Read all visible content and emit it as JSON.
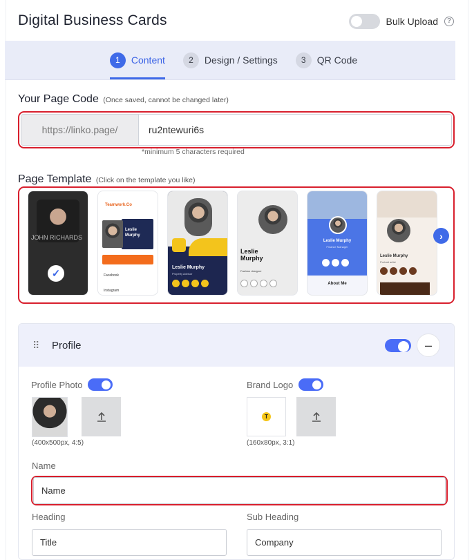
{
  "header": {
    "title": "Digital Business Cards",
    "bulk_label": "Bulk Upload",
    "help_symbol": "?"
  },
  "steps": [
    {
      "num": "1",
      "label": "Content",
      "active": true
    },
    {
      "num": "2",
      "label": "Design / Settings",
      "active": false
    },
    {
      "num": "3",
      "label": "QR Code",
      "active": false
    }
  ],
  "page_code": {
    "label": "Your Page Code",
    "note": "(Once saved, cannot be changed later)",
    "prefix": "https://linko.page/",
    "value": "ru2ntewuri6s",
    "hint": "*minimum 5 characters required"
  },
  "template": {
    "label": "Page Template",
    "note": "(Click on the template you like)",
    "cards": [
      {
        "name": "JOHN RICHARDS",
        "selected": true
      },
      {
        "name": "Leslie Murphy",
        "brand": "Teamwork.Co",
        "extra": "Facebook",
        "extra2": "Instagram"
      },
      {
        "name": "Leslie Murphy",
        "sub": "Property Advisor"
      },
      {
        "name": "Leslie Murphy",
        "sub": "Fashion designer"
      },
      {
        "name": "Leslie Murphy",
        "sub": "Finance Manager",
        "extra": "About Me"
      },
      {
        "name": "Leslie Murphy",
        "sub": "Portrait artist"
      }
    ],
    "next_symbol": "›"
  },
  "profile": {
    "title": "Profile",
    "photo_label": "Profile Photo",
    "photo_size": "(400x500px, 4:5)",
    "logo_label": "Brand Logo",
    "logo_size": "(160x80px, 3:1)",
    "logo_letter": "T",
    "name_label": "Name",
    "name_placeholder": "Name",
    "heading_label": "Heading",
    "heading_placeholder": "Title",
    "subheading_label": "Sub Heading",
    "subheading_placeholder": "Company",
    "collapse_symbol": "–",
    "drag_symbol": "⠿"
  },
  "colors": {
    "accent": "#3f6ae8",
    "highlight": "#d81e2c",
    "steps_bg": "#e9ecf8"
  }
}
